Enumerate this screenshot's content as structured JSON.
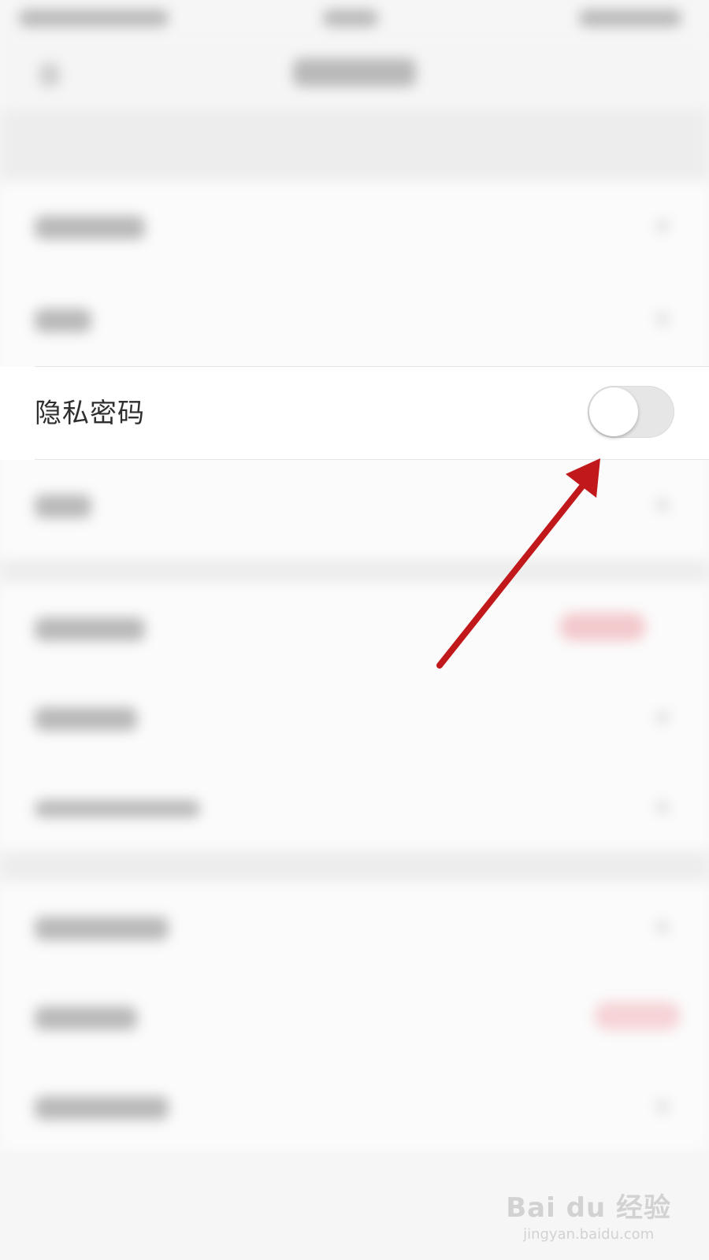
{
  "privacy_password": {
    "label": "隐私密码",
    "enabled": false
  },
  "colors": {
    "arrow": "#c0181b",
    "toggle_off_track": "#e6e6e6",
    "toggle_knob": "#ffffff"
  },
  "watermark": {
    "logo": "Bai du 经验",
    "url": "jingyan.baidu.com"
  }
}
